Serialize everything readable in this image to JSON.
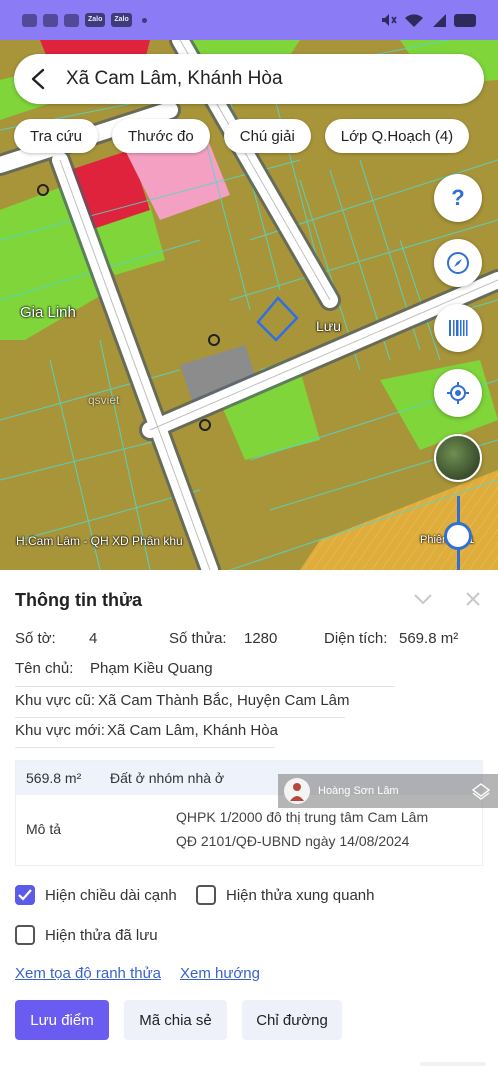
{
  "status_bar": {
    "left_icons": [
      "gallery-icon",
      "shield-icon",
      "screen-record-icon",
      "zalo-icon",
      "zalo-icon"
    ],
    "zalo_label": "Zalo",
    "right_icons": [
      "mute-icon",
      "wifi-icon",
      "signal-icon",
      "battery-icon"
    ]
  },
  "search": {
    "title": "Xã Cam Lâm, Khánh Hòa"
  },
  "chips": [
    "Tra cứu",
    "Thước đo",
    "Chú giải",
    "Lớp Q.Hoạch (4)"
  ],
  "map": {
    "place_label": "Gia Linh",
    "place_label_2": "Lưu",
    "watermark": "qsviet",
    "layer_label": "H.Cam Lâm - QH XD Phân khu",
    "phien_label": "Phiên",
    "phien_suffix": "1"
  },
  "fab_icons": [
    "help-icon",
    "compass-icon",
    "barcode-icon",
    "locate-icon",
    "satellite-thumb"
  ],
  "panel": {
    "title": "Thông tin thửa",
    "so_to_label": "Số tờ:",
    "so_to": "4",
    "so_thua_label": "Số thửa:",
    "so_thua": "1280",
    "dien_tich_label": "Diện tích:",
    "dien_tich": "569.8 m²",
    "ten_chu_label": "Tên chủ:",
    "ten_chu": "Phạm Kiều Quang",
    "kv_cu_label": "Khu vực cũ:",
    "kv_cu": "Xã Cam Thành Bắc, Huyện Cam Lâm",
    "kv_moi_label": "Khu vực mới:",
    "kv_moi": "Xã Cam Lâm, Khánh Hòa",
    "table": {
      "area": "569.8 m²",
      "land_use": "Đất ở nhóm nhà ở",
      "desc_label": "Mô tả",
      "desc_line1": "QHPK 1/2000 đô thị trung tâm Cam Lâm",
      "desc_line2": "QĐ 2101/QĐ-UBND ngày 14/08/2024"
    },
    "watermark_name": "Hoàng Sơn Lâm",
    "checkboxes": [
      {
        "label": "Hiện chiều dài cạnh",
        "checked": true
      },
      {
        "label": "Hiện thửa xung quanh",
        "checked": false
      },
      {
        "label": "Hiện thửa đã lưu",
        "checked": false
      }
    ],
    "links": [
      "Xem tọa độ ranh thửa",
      "Xem hướng"
    ],
    "buttons": [
      "Lưu điểm",
      "Mã chia sẻ",
      "Chỉ đường"
    ]
  },
  "colors": {
    "status_bar": "#8b7cf6",
    "primary": "#6a5cf0",
    "link": "#3a62c9",
    "map_base": "#a8953a",
    "map_green": "#7fd53a",
    "map_red": "#e0233c",
    "map_pink": "#f3a0c2",
    "map_orange": "#e0ac3a",
    "road": "#ffffff",
    "parcel_line": "#4fd8d0",
    "selected_parcel": "#2e6fe8"
  }
}
